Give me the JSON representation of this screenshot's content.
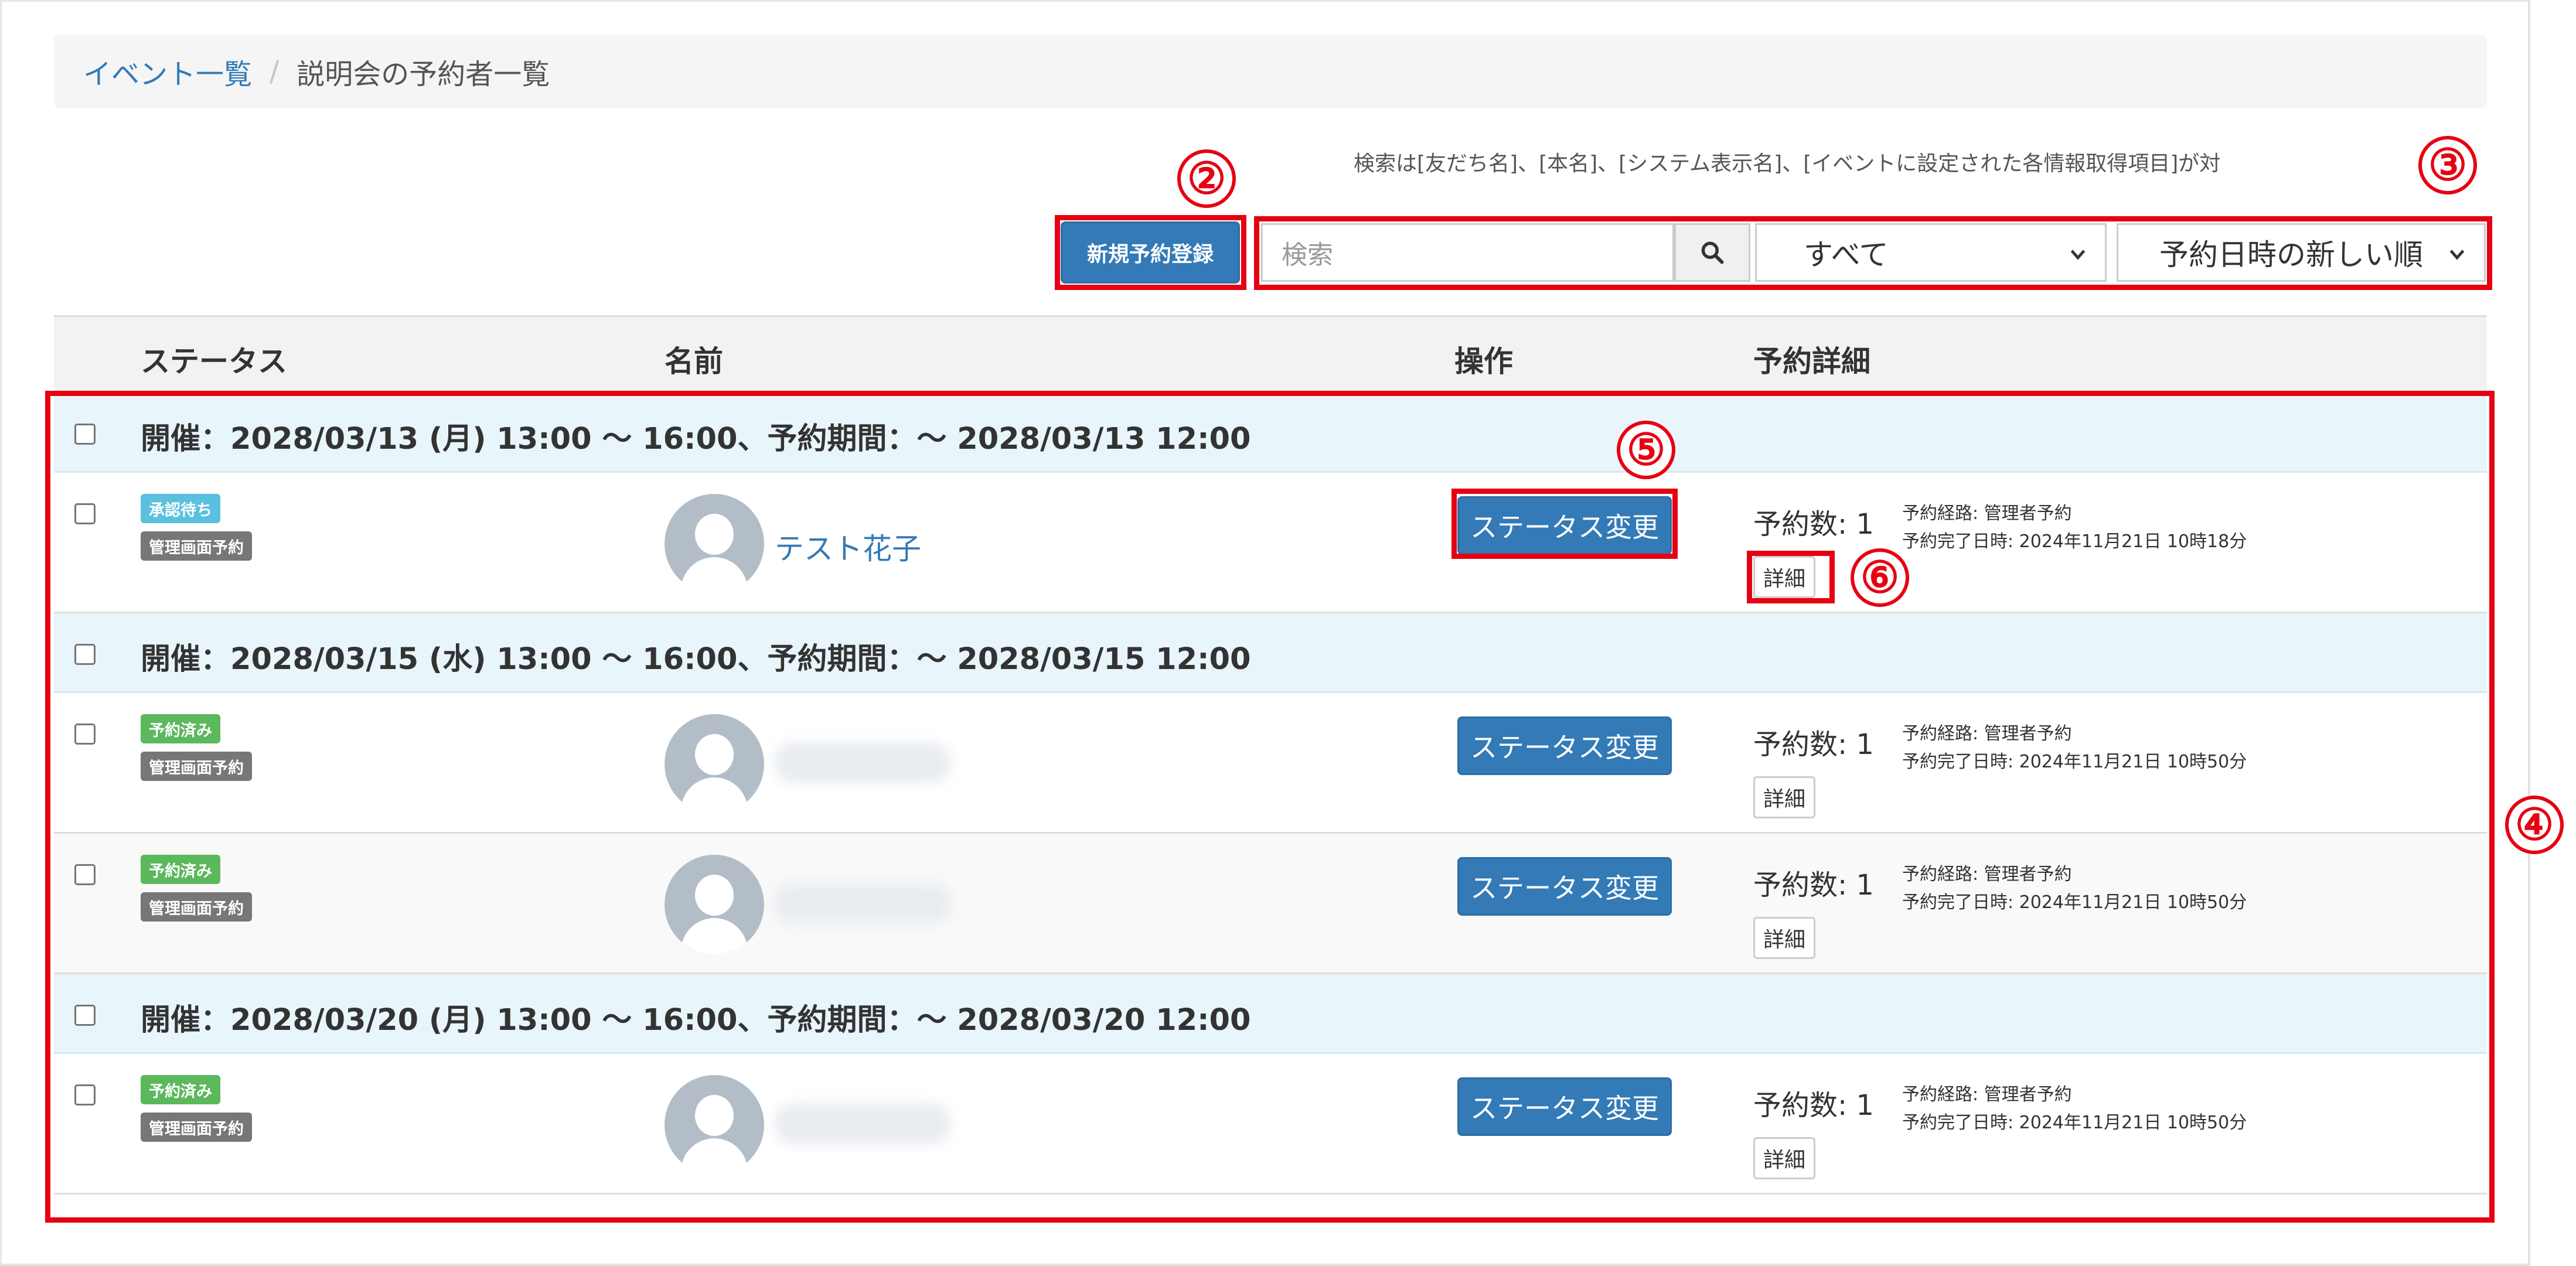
{
  "breadcrumb": {
    "link": "イベント一覧",
    "separator": "/",
    "current": "説明会の予約者一覧"
  },
  "search_note": "検索は[友だち名]、[本名]、[システム表示名]、[イベントに設定された各情報取得項目]が対",
  "toolbar": {
    "new_reservation_label": "新規予約登録",
    "search_placeholder": "検索",
    "filter_selected": "すべて",
    "sort_selected": "予約日時の新しい順"
  },
  "table": {
    "headers": [
      "ステータス",
      "名前",
      "操作",
      "予約詳細"
    ],
    "groups": [
      {
        "label": "開催：2028/03/13 (月) 13:00 ～ 16:00、予約期間：～ 2028/03/13 12:00",
        "rows": [
          {
            "status": "承認待ち",
            "route_badge": "管理画面予約",
            "name": "テスト花子",
            "action": "ステータス変更",
            "count": "予約数: 1",
            "route": "予約経路: 管理者予約",
            "completed": "予約完了日時: 2024年11月21日 10時18分",
            "detail": "詳細"
          }
        ]
      },
      {
        "label": "開催：2028/03/15 (水) 13:00 ～ 16:00、予約期間：～ 2028/03/15 12:00",
        "rows": [
          {
            "status": "予約済み",
            "route_badge": "管理画面予約",
            "name": "",
            "action": "ステータス変更",
            "count": "予約数: 1",
            "route": "予約経路: 管理者予約",
            "completed": "予約完了日時: 2024年11月21日 10時50分",
            "detail": "詳細"
          },
          {
            "status": "予約済み",
            "route_badge": "管理画面予約",
            "name": "",
            "action": "ステータス変更",
            "count": "予約数: 1",
            "route": "予約経路: 管理者予約",
            "completed": "予約完了日時: 2024年11月21日 10時50分",
            "detail": "詳細"
          }
        ]
      },
      {
        "label": "開催：2028/03/20 (月) 13:00 ～ 16:00、予約期間：～ 2028/03/20 12:00",
        "rows": [
          {
            "status": "予約済み",
            "route_badge": "管理画面予約",
            "name": "",
            "action": "ステータス変更",
            "count": "予約数: 1",
            "route": "予約経路: 管理者予約",
            "completed": "予約完了日時: 2024年11月21日 10時50分",
            "detail": "詳細"
          }
        ]
      }
    ]
  },
  "annotations": [
    "②",
    "③",
    "④",
    "⑤",
    "⑥"
  ],
  "colors": {
    "annotation_red": "#e60012",
    "primary_blue": "#337ab7",
    "group_bg": "#e8f5fb",
    "badge_waiting": "#5bc0de",
    "badge_reserved": "#5cb85c",
    "badge_route": "#777777"
  }
}
